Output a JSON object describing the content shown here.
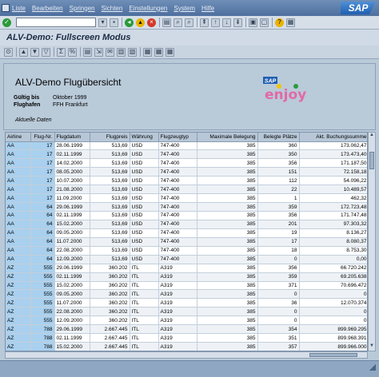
{
  "menubar": {
    "items": [
      "Liste",
      "Bearbeiten",
      "Springen",
      "Sichten",
      "Einstellungen",
      "System",
      "Hilfe"
    ],
    "brand": "SAP"
  },
  "std_toolbar": {
    "command_field_value": "",
    "icons": [
      "enter-icon",
      "save-icon",
      "back-icon",
      "exit-icon",
      "cancel-icon",
      "print-icon",
      "find-icon",
      "find-next-icon",
      "first-page-icon",
      "prev-page-icon",
      "next-page-icon",
      "last-page-icon",
      "new-session-icon",
      "shortcut-icon",
      "help-icon",
      "layout-icon"
    ]
  },
  "title": "ALV-Demo: Fullscreen Modus",
  "app_toolbar": {
    "icons": [
      "details-icon",
      "sort-ascending-icon",
      "sort-descending-icon",
      "filter-icon",
      "sum-icon",
      "subtotal-icon",
      "print-preview-icon",
      "export-icon",
      "mail-icon",
      "graphic-icon",
      "abc-analysis-icon",
      "layout-select-icon",
      "layout-change-icon",
      "layout-save-icon"
    ]
  },
  "header": {
    "title": "ALV-Demo Flugübersicht",
    "fields": [
      {
        "label": "Gültig bis",
        "value": "Oktober 1999"
      },
      {
        "label": "Flughafen",
        "value": "FFH Frankfurt"
      }
    ],
    "aktuelle": "Aktuelle Daten",
    "logo_text": "enjoy",
    "logo_sap": "SAP"
  },
  "grid": {
    "columns": [
      "Airline",
      "Flug-Nr.",
      "Flugdatum",
      "Flugpreis",
      "Währung",
      "Flugzeugtyp",
      "Maximale Belegung",
      "Belegte Plätze",
      "Akt. Buchungssumme"
    ],
    "rows": [
      [
        "AA",
        "17",
        "28.06.1999",
        "513,69",
        "USD",
        "747-400",
        "385",
        "360",
        "173.062,47"
      ],
      [
        "AA",
        "17",
        "02.11.1999",
        "513,69",
        "USD",
        "747-400",
        "385",
        "350",
        "173.473,40"
      ],
      [
        "AA",
        "17",
        "14.02.2000",
        "513,69",
        "USD",
        "747-400",
        "385",
        "356",
        "171.187,50"
      ],
      [
        "AA",
        "17",
        "08.05.2000",
        "513,69",
        "USD",
        "747-400",
        "385",
        "151",
        "72.158,18"
      ],
      [
        "AA",
        "17",
        "10.07.2000",
        "513,69",
        "USD",
        "747-400",
        "385",
        "112",
        "54.096,22"
      ],
      [
        "AA",
        "17",
        "21.08.2000",
        "513,69",
        "USD",
        "747-400",
        "385",
        "22",
        "10.489,57"
      ],
      [
        "AA",
        "17",
        "11.09.2000",
        "513,69",
        "USD",
        "747-400",
        "385",
        "1",
        "462,32"
      ],
      [
        "AA",
        "64",
        "29.06.1999",
        "513,69",
        "USD",
        "747-400",
        "385",
        "359",
        "172.723,48"
      ],
      [
        "AA",
        "64",
        "02.11.1999",
        "513,69",
        "USD",
        "747-400",
        "385",
        "356",
        "171.747,48"
      ],
      [
        "AA",
        "64",
        "15.02.2000",
        "513,69",
        "USD",
        "747-400",
        "385",
        "201",
        "97.303,32"
      ],
      [
        "AA",
        "64",
        "09.05.2000",
        "513,69",
        "USD",
        "747-400",
        "385",
        "19",
        "8.136,27"
      ],
      [
        "AA",
        "64",
        "11.07.2000",
        "513,69",
        "USD",
        "747-400",
        "385",
        "17",
        "8.080,37"
      ],
      [
        "AA",
        "64",
        "22.08.2000",
        "513,69",
        "USD",
        "747-400",
        "385",
        "18",
        "8.753,30"
      ],
      [
        "AA",
        "64",
        "12.09.2000",
        "513,69",
        "USD",
        "747-400",
        "385",
        "0",
        "0,00"
      ],
      [
        "AZ",
        "555",
        "29.06.1999",
        "360.202",
        "ITL",
        "A319",
        "385",
        "356",
        "66.720.242"
      ],
      [
        "AZ",
        "555",
        "02.11.1999",
        "360.202",
        "ITL",
        "A319",
        "385",
        "359",
        "69.205.638"
      ],
      [
        "AZ",
        "555",
        "15.02.2000",
        "360.202",
        "ITL",
        "A319",
        "385",
        "371",
        "70.696.472"
      ],
      [
        "AZ",
        "555",
        "09.05.2000",
        "360.202",
        "ITL",
        "A319",
        "385",
        "0",
        "0"
      ],
      [
        "AZ",
        "555",
        "11.07.2000",
        "360.202",
        "ITL",
        "A319",
        "385",
        "36",
        "12.070.374"
      ],
      [
        "AZ",
        "555",
        "22.08.2000",
        "360.202",
        "ITL",
        "A319",
        "385",
        "0",
        "0"
      ],
      [
        "AZ",
        "555",
        "12.09.2000",
        "360.202",
        "ITL",
        "A319",
        "385",
        "0",
        "0"
      ],
      [
        "AZ",
        "788",
        "29.06.1999",
        "2.667.445",
        "ITL",
        "A319",
        "385",
        "354",
        "899.969.295"
      ],
      [
        "AZ",
        "788",
        "02.11.1999",
        "2.667.445",
        "ITL",
        "A319",
        "385",
        "351",
        "899.968.391"
      ],
      [
        "AZ",
        "788",
        "15.02.2000",
        "2.667.445",
        "ITL",
        "A319",
        "385",
        "357",
        "899.966.000"
      ]
    ]
  }
}
